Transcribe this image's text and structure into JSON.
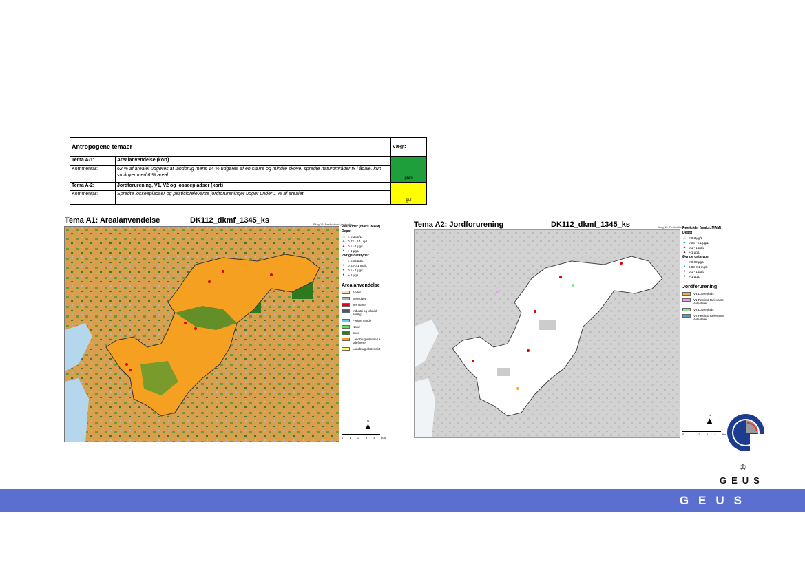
{
  "table": {
    "header": "Antropogene temaer",
    "weight_header": "Vægt:",
    "rows": [
      {
        "theme": "Tema A-1:",
        "title": "Arealanvendelse (kort)",
        "comment_label": "Kommentar:",
        "comment": "62 % af arealet udgøres af landbrug mens 14 % udgøres af en større og mindre skove. spredte naturområder fx i ådale. kun småbyer med 6 % areal.",
        "weight": "grøn",
        "color": "#1f9e3c"
      },
      {
        "theme": "Tema A-2:",
        "title": "Jordforurening, V1,  V2 og losseepladser (kort)",
        "comment_label": "Kommentar:",
        "comment": "Spredte losseepladser og pesticidrelevante jordforureninger udgør under 1 % af arealet",
        "weight": "gul",
        "color": "#ffff00"
      }
    ]
  },
  "map1": {
    "title": "Tema A1: Arealanvendelse",
    "code": "DK112_dkmf_1345_ks",
    "note": "Bilag 15. Pesticidfund pesticider",
    "legend_title": "Pesticider (maks. MAM)",
    "depot": "Depot",
    "depot_items": [
      "< 0.3 µg/L",
      "0.03 - 0.1 µg/L",
      "0.1 - 1 µg/L",
      "> 1 µg/L"
    ],
    "other_title": "Øvrige datatyper",
    "other_items": [
      "< 0.03 µg/L",
      "0.03-0.1 mg/L",
      "0.1 - 1 µg/L",
      "> 1 µg/L"
    ],
    "landuse_title": "Arealanvendelse",
    "landuse": [
      {
        "label": "Andet",
        "color": "#f5e2b8"
      },
      {
        "label": "Bebygget",
        "color": "#b4b4b4"
      },
      {
        "label": "Jernbane",
        "color": "#e6001e"
      },
      {
        "label": "Industri og teknisk anlæg",
        "color": "#555566"
      },
      {
        "label": "Ferske vande",
        "color": "#6ec8f0"
      },
      {
        "label": "Natur",
        "color": "#5ce35c"
      },
      {
        "label": "Skov",
        "color": "#2d7a1e"
      },
      {
        "label": "Landbrug intensivt + udefineret",
        "color": "#f5a020"
      },
      {
        "label": "Landbrug ekstensivt",
        "color": "#ffff66"
      }
    ],
    "scale": [
      "0",
      "1",
      "2",
      "3",
      "4"
    ],
    "scale_unit": "Km",
    "north": "N"
  },
  "map2": {
    "title": "Tema A2: Jordforurening",
    "code": "DK112_dkmf_1345_ks",
    "note": "Bilag 15. Pesticidfund pesticider",
    "legend_title": "Pesticider (maks. MAM)",
    "depot": "Depot",
    "depot_items": [
      "< 0.3 µg/L",
      "0.03 - 0.1 µg/L",
      "0.1 - 1 µg/L",
      "> 1 µg/L"
    ],
    "other_title": "Øvrige datatyper",
    "other_items": [
      "< 0.03 µg/L",
      "0.03-0.1 mg/L",
      "0.1 - 1 µg/L",
      "> 1 µg/L"
    ],
    "pollution_title": "Jordforurening",
    "pollution": [
      {
        "label": "V1 Losseplads",
        "color": "#f5b23c"
      },
      {
        "label": "V1 Pesticid Relevante Aktiviteter",
        "color": "#e6a0e6"
      },
      {
        "label": "V2 Losseplads",
        "color": "#8ce68c"
      },
      {
        "label": "V2 Pesticid Relevante Aktiviteter",
        "color": "#5a96e6"
      }
    ],
    "scale": [
      "0",
      "1",
      "2",
      "3",
      "4"
    ],
    "scale_unit": "Km",
    "north": "N"
  },
  "brand": {
    "logo_text": "GEUS",
    "footer_text": "GEUS",
    "footer_color": "#5b6fd1"
  }
}
